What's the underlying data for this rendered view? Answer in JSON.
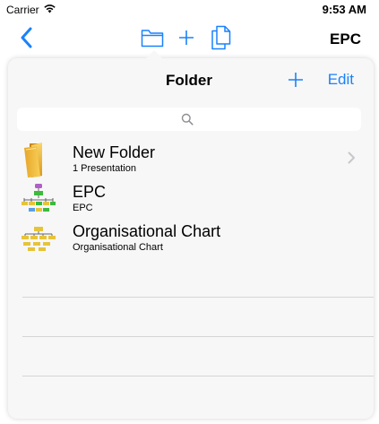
{
  "status_bar": {
    "carrier": "Carrier",
    "time": "9:53 AM"
  },
  "nav": {
    "title": "EPC",
    "icons": [
      "back-icon",
      "folder-icon",
      "plus-icon",
      "copy-icon"
    ],
    "accent_color": "#1a82fb"
  },
  "popover": {
    "title": "Folder",
    "edit_label": "Edit",
    "items": [
      {
        "title": "New Folder",
        "subtitle": "1 Presentation",
        "icon": "folder-icon",
        "has_chevron": true
      },
      {
        "title": "EPC",
        "subtitle": "EPC",
        "icon": "epc-diagram-icon",
        "has_chevron": false
      },
      {
        "title": "Organisational Chart",
        "subtitle": "Organisational Chart",
        "icon": "org-chart-icon",
        "has_chevron": false
      }
    ]
  }
}
